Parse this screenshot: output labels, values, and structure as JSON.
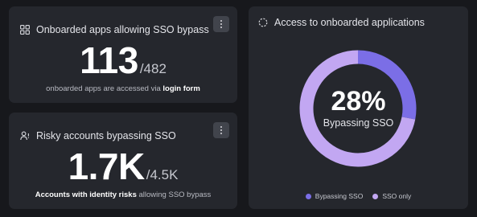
{
  "colors": {
    "background": "#17181c",
    "card": "#25272d",
    "bypassing": "#7b6ee6",
    "sso_only": "#c2a7f2"
  },
  "card1": {
    "title": "Onboarded apps allowing SSO bypass",
    "icon": "apps-grid-icon",
    "value": "113",
    "total": "/482",
    "caption_prefix": "onboarded apps are accessed via ",
    "caption_bold": "login form"
  },
  "card2": {
    "title": "Risky accounts bypassing SSO",
    "icon": "user-risk-icon",
    "value": "1.7K",
    "total": "/4.5K",
    "caption_bold": "Accounts with identity risks",
    "caption_suffix": " allowing SSO bypass"
  },
  "card3": {
    "title": "Access to onboarded applications",
    "icon": "circle-loading-icon",
    "center_value": "28%",
    "center_label": "Bypassing SSO"
  },
  "chart_data": {
    "type": "pie",
    "donut": true,
    "categories": [
      "Bypassing SSO",
      "SSO only"
    ],
    "values": [
      28,
      72
    ],
    "legend_position": "bottom"
  }
}
